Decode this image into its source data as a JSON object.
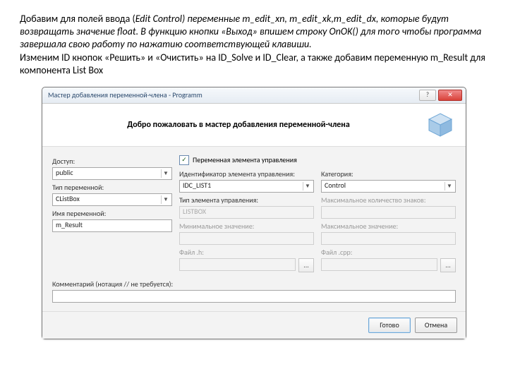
{
  "paragraph": {
    "p1a": " Добавим для полей ввода (",
    "p1b": "Edit Control) переменные m_edit_xn, m_edit_xk,m_edit_dx, которые будут возвращать значение float. В функцию кнопки «Выход» впишем строку OnOK() для того чтобы программа завершала свою работу по нажатию соответствующей клавиши.",
    "p2": "Изменим ID кнопок «Решить» и «Очистить» на ID_Solve и ID_Clear, а также добавим переменную m_Result для компонента List Box"
  },
  "window": {
    "title": "Мастер добавления переменной-члена - Programm",
    "header": "Добро пожаловать в мастер добавления переменной-члена",
    "labels": {
      "access": "Доступ:",
      "vartype": "Тип переменной:",
      "varname": "Имя переменной:",
      "ctrlvar": "Переменная элемента управления",
      "ctrlid": "Идентификатор элемента управления:",
      "ctrltype": "Тип элемента управления:",
      "minval": "Минимальное значение:",
      "fileh": "Файл .h:",
      "category": "Категория:",
      "maxchars": "Максимальное количество знаков:",
      "maxval": "Максимальное значение:",
      "filecpp": "Файл .cpp:",
      "comment": "Комментарий (нотация // не требуется):"
    },
    "values": {
      "access": "public",
      "vartype": "CListBox",
      "varname": "m_Result",
      "ctrlid": "IDC_LIST1",
      "ctrltype": "LISTBOX",
      "category": "Control"
    },
    "buttons": {
      "finish": "Готово",
      "cancel": "Отмена"
    },
    "checkbox_checked": "✓",
    "dots": "..."
  }
}
